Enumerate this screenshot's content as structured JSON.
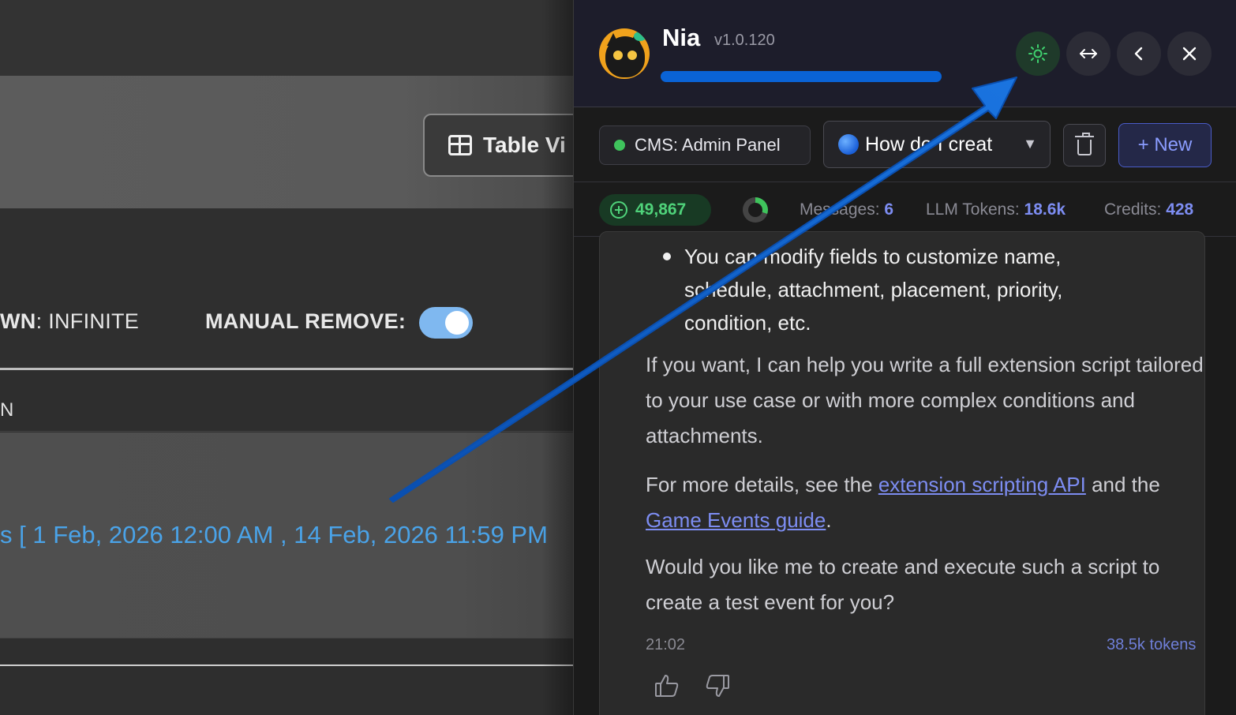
{
  "background_app": {
    "table_view_label": "Table Vi",
    "cooldown_prefix": "WN",
    "cooldown_value": ": INFINITE",
    "manual_remove_label": "MANUAL REMOVE:",
    "manual_remove_on": true,
    "column_header_fragment": "N",
    "date_range": "s [  1 Feb, 2026 12:00 AM  ,  14 Feb, 2026 11:59 PM"
  },
  "panel": {
    "bot_name": "Nia",
    "version": "v1.0.120",
    "email_visible_fragment": "          ",
    "header_buttons": [
      {
        "name": "status",
        "icon": "sun-status-icon"
      },
      {
        "name": "resize",
        "icon": "resize-icon"
      },
      {
        "name": "back",
        "icon": "chevron-left-icon"
      },
      {
        "name": "close",
        "icon": "close-icon"
      }
    ],
    "context_label": "CMS: Admin Panel",
    "conversation_title": "How do I creat",
    "new_label": "+ New",
    "balance": "49,867",
    "messages_label": "Messages:",
    "messages_value": "6",
    "llm_tokens_label": "LLM Tokens:",
    "llm_tokens_value": "18.6k",
    "credits_label": "Credits:",
    "credits_value": "428"
  },
  "message": {
    "bullet": "You can modify fields to customize name, schedule, attachment, placement, priority, condition, etc.",
    "para1": "If you want, I can help you write a full extension script tailored to your use case or with more complex conditions and attachments.",
    "para2_prefix": "For more details, see the ",
    "link1": "extension scripting API",
    "para2_mid": " and the ",
    "link2": "Game Events guide",
    "para2_suffix": ".",
    "para3": "Would you like me to create and execute such a script to create a test event for you?",
    "time": "21:02",
    "tokens": "38.5k tokens"
  },
  "colors": {
    "accent": "#7d8df2",
    "success": "#3fc35c",
    "arrow": "#0a63d6"
  }
}
